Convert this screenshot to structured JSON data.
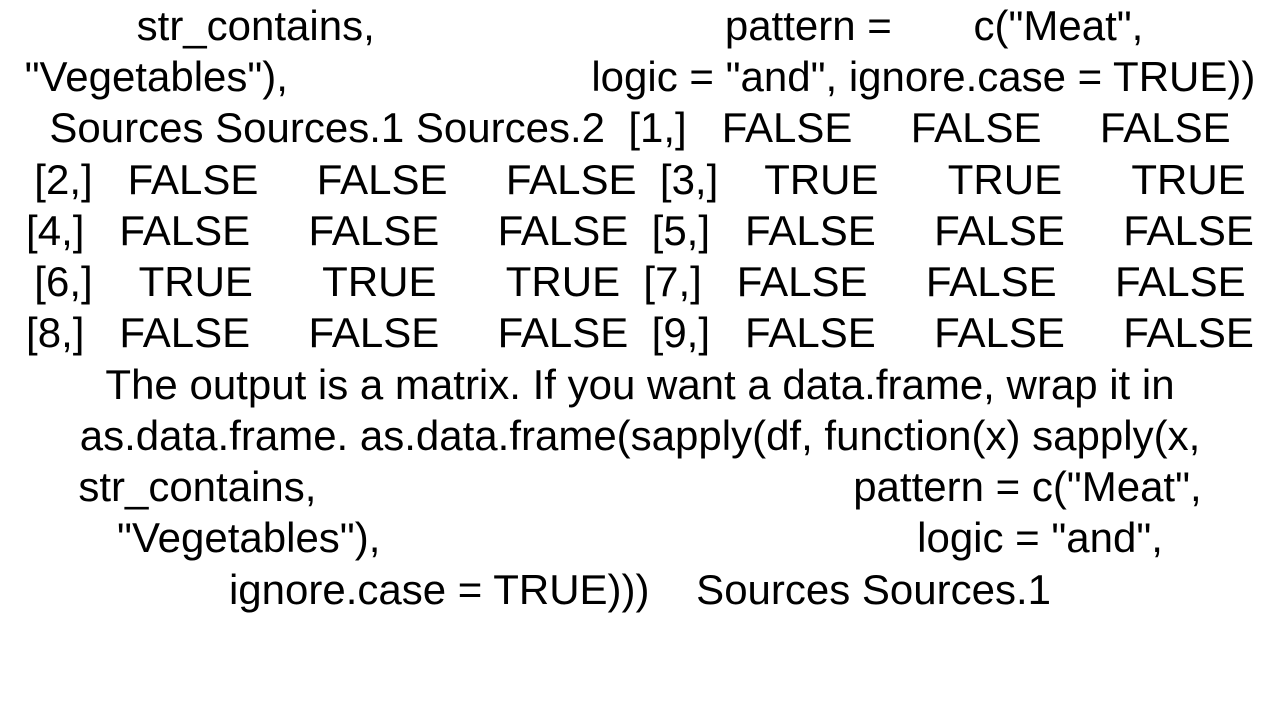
{
  "body": "str_contains,                              pattern =       c(\"Meat\", \"Vegetables\"),                          logic = \"and\", ignore.case = TRUE))        Sources Sources.1 Sources.2  [1,]   FALSE     FALSE     FALSE  [2,]   FALSE     FALSE     FALSE  [3,]    TRUE      TRUE      TRUE  [4,]   FALSE     FALSE     FALSE  [5,]   FALSE     FALSE     FALSE  [6,]    TRUE      TRUE      TRUE  [7,]   FALSE     FALSE     FALSE  [8,]   FALSE     FALSE     FALSE  [9,]   FALSE     FALSE     FALSE  The output is a matrix. If you want a data.frame, wrap it in as.data.frame. as.data.frame(sapply(df, function(x) sapply(x, str_contains,                                              pattern = c(\"Meat\", \"Vegetables\"),                                              logic = \"and\", ignore.case = TRUE)))    Sources Sources.1"
}
